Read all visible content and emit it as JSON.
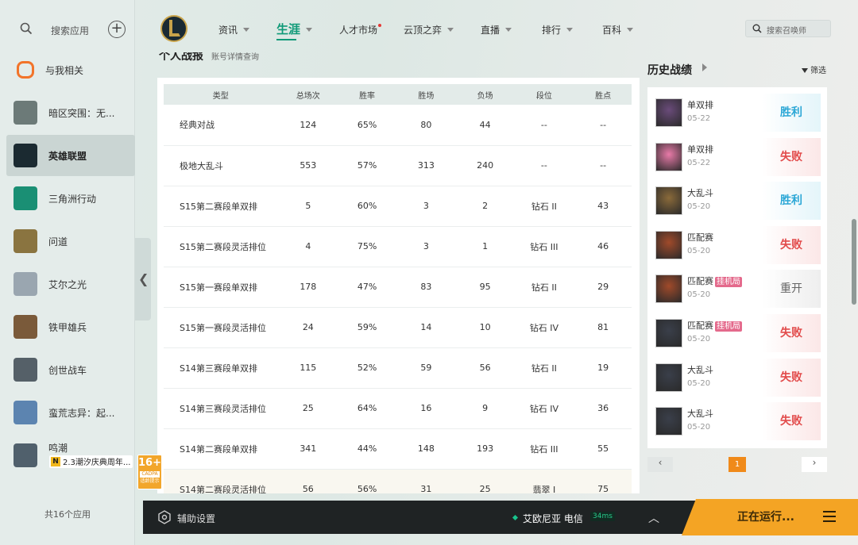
{
  "sidebar": {
    "search_label": "搜索应用",
    "add_label": "+",
    "items": [
      {
        "label": "与我相关",
        "icon": "related-icon"
      },
      {
        "label": "暗区突围：无...",
        "icon": "game-icon"
      },
      {
        "label": "英雄联盟",
        "icon": "lol-icon"
      },
      {
        "label": "三角洲行动",
        "icon": "game-icon"
      },
      {
        "label": "问道",
        "icon": "game-icon"
      },
      {
        "label": "艾尔之光",
        "icon": "game-icon"
      },
      {
        "label": "铁甲雄兵",
        "icon": "game-icon"
      },
      {
        "label": "创世战车",
        "icon": "game-icon"
      },
      {
        "label": "蛮荒志异：起...",
        "icon": "game-icon"
      },
      {
        "label": "鸣潮",
        "icon": "game-icon"
      }
    ],
    "wuchao_sub": "2.3潮汐庆典周年...",
    "wuchao_badge": "N",
    "count": "共16个应用"
  },
  "nav": {
    "items": [
      {
        "label": "资讯",
        "caret": true
      },
      {
        "label": "生涯",
        "caret": true,
        "active": true
      },
      {
        "label": "人才市场",
        "dot": true
      },
      {
        "label": "云顶之弈",
        "caret": true
      },
      {
        "label": "直播",
        "caret": true
      },
      {
        "label": "排行",
        "caret": true
      },
      {
        "label": "百科",
        "caret": true
      }
    ],
    "search_placeholder": "搜索召唤师"
  },
  "section": {
    "title": "个人战报",
    "subtitle": "账号详情查询"
  },
  "table": {
    "headers": [
      "类型",
      "总场次",
      "胜率",
      "胜场",
      "负场",
      "段位",
      "胜点"
    ],
    "rows": [
      [
        "经典对战",
        "124",
        "65%",
        "80",
        "44",
        "--",
        "--"
      ],
      [
        "极地大乱斗",
        "553",
        "57%",
        "313",
        "240",
        "--",
        "--"
      ],
      [
        "S15第二赛段单双排",
        "5",
        "60%",
        "3",
        "2",
        "钻石 II",
        "43"
      ],
      [
        "S15第二赛段灵活排位",
        "4",
        "75%",
        "3",
        "1",
        "钻石 III",
        "46"
      ],
      [
        "S15第一赛段单双排",
        "178",
        "47%",
        "83",
        "95",
        "钻石 II",
        "29"
      ],
      [
        "S15第一赛段灵活排位",
        "24",
        "59%",
        "14",
        "10",
        "钻石 IV",
        "81"
      ],
      [
        "S14第三赛段单双排",
        "115",
        "52%",
        "59",
        "56",
        "钻石 II",
        "19"
      ],
      [
        "S14第三赛段灵活排位",
        "25",
        "64%",
        "16",
        "9",
        "钻石 IV",
        "36"
      ],
      [
        "S14第二赛段单双排",
        "341",
        "44%",
        "148",
        "193",
        "钻石 III",
        "55"
      ],
      [
        "S14第二赛段灵活排位",
        "56",
        "56%",
        "31",
        "25",
        "翡翠 I",
        "75"
      ]
    ]
  },
  "history": {
    "title": "历史战绩",
    "filter": "筛选",
    "items": [
      {
        "mode": "单双排",
        "tag": "",
        "date": "05-22",
        "result": "胜利",
        "kind": "win",
        "color": "#6a4b7a"
      },
      {
        "mode": "单双排",
        "tag": "",
        "date": "05-22",
        "result": "失败",
        "kind": "lose",
        "color": "#e87aa8"
      },
      {
        "mode": "大乱斗",
        "tag": "",
        "date": "05-20",
        "result": "胜利",
        "kind": "win",
        "color": "#8a6a3a"
      },
      {
        "mode": "匹配赛",
        "tag": "",
        "date": "05-20",
        "result": "失败",
        "kind": "lose",
        "color": "#a04a2a"
      },
      {
        "mode": "匹配赛",
        "tag": "挂机局",
        "date": "05-20",
        "result": "重开",
        "kind": "re",
        "color": "#a04a2a"
      },
      {
        "mode": "匹配赛",
        "tag": "挂机局",
        "date": "05-20",
        "result": "失败",
        "kind": "lose",
        "color": "#3a3f4a"
      },
      {
        "mode": "大乱斗",
        "tag": "",
        "date": "05-20",
        "result": "失败",
        "kind": "lose",
        "color": "#3a3f4a"
      },
      {
        "mode": "大乱斗",
        "tag": "",
        "date": "05-20",
        "result": "失败",
        "kind": "lose",
        "color": "#3a3f4a"
      }
    ],
    "prev": "‹",
    "page": "1",
    "next": "›"
  },
  "bottom": {
    "settings": "辅助设置",
    "server": "艾欧尼亚 电信",
    "ping": "34ms",
    "up": "^",
    "running": "正在运行..."
  },
  "badge": {
    "age": "16+",
    "sub": "CADPA",
    "note": "适龄提示"
  },
  "colors": {
    "accent": "#0f9a78",
    "win": "#2ba7d6",
    "lose": "#e24b4b",
    "running": "#f4a424"
  }
}
